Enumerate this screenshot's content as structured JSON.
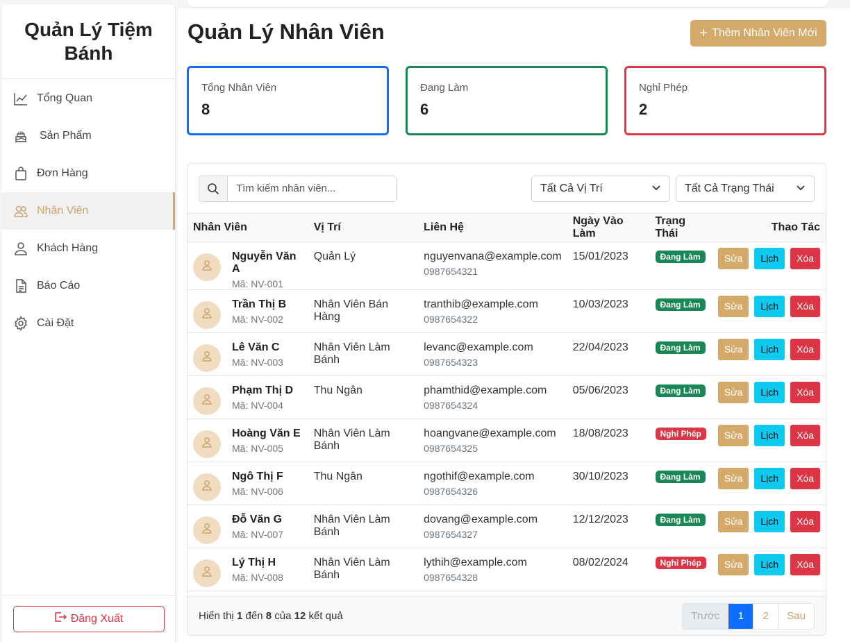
{
  "brand": "Quản Lý Tiệm Bánh",
  "nav": [
    {
      "label": "Tổng Quan",
      "icon": "chart-line-icon"
    },
    {
      "label": "Sản Phẩm",
      "icon": "cake-icon"
    },
    {
      "label": "Đơn Hàng",
      "icon": "shopping-bag-icon"
    },
    {
      "label": "Nhân Viên",
      "icon": "users-icon"
    },
    {
      "label": "Khách Hàng",
      "icon": "user-icon"
    },
    {
      "label": "Báo Cáo",
      "icon": "document-icon"
    },
    {
      "label": "Cài Đặt",
      "icon": "gear-icon"
    }
  ],
  "logout_label": "Đăng Xuất",
  "page_title": "Quản Lý Nhân Viên",
  "add_button": "Thêm Nhân Viên Mới",
  "stats": {
    "total": {
      "label": "Tổng Nhân Viên",
      "value": "8"
    },
    "working": {
      "label": "Đang Làm",
      "value": "6"
    },
    "leave": {
      "label": "Nghỉ Phép",
      "value": "2"
    }
  },
  "search": {
    "placeholder": "Tìm kiếm nhân viên..."
  },
  "filters": {
    "position": "Tất Cả Vị Trí",
    "status": "Tất Cả Trạng Thái"
  },
  "columns": {
    "employee": "Nhân Viên",
    "position": "Vị Trí",
    "contact": "Liên Hệ",
    "start_date": "Ngày Vào Làm",
    "status": "Trạng Thái",
    "actions": "Thao Tác"
  },
  "actions": {
    "edit": "Sửa",
    "schedule": "Lịch",
    "delete": "Xóa"
  },
  "employees": [
    {
      "name": "Nguyễn Văn A",
      "code": "Mã: NV-001",
      "position": "Quản Lý",
      "email": "nguyenvana@example.com",
      "phone": "0987654321",
      "date": "15/01/2023",
      "status": "Đang Làm"
    },
    {
      "name": "Trần Thị B",
      "code": "Mã: NV-002",
      "position": "Nhân Viên Bán Hàng",
      "email": "tranthib@example.com",
      "phone": "0987654322",
      "date": "10/03/2023",
      "status": "Đang Làm"
    },
    {
      "name": "Lê Văn C",
      "code": "Mã: NV-003",
      "position": "Nhân Viên Làm Bánh",
      "email": "levanc@example.com",
      "phone": "0987654323",
      "date": "22/04/2023",
      "status": "Đang Làm"
    },
    {
      "name": "Phạm Thị D",
      "code": "Mã: NV-004",
      "position": "Thu Ngân",
      "email": "phamthid@example.com",
      "phone": "0987654324",
      "date": "05/06/2023",
      "status": "Đang Làm"
    },
    {
      "name": "Hoàng Văn E",
      "code": "Mã: NV-005",
      "position": "Nhân Viên Làm Bánh",
      "email": "hoangvane@example.com",
      "phone": "0987654325",
      "date": "18/08/2023",
      "status": "Nghỉ Phép"
    },
    {
      "name": "Ngô Thị F",
      "code": "Mã: NV-006",
      "position": "Thu Ngân",
      "email": "ngothif@example.com",
      "phone": "0987654326",
      "date": "30/10/2023",
      "status": "Đang Làm"
    },
    {
      "name": "Đỗ Văn G",
      "code": "Mã: NV-007",
      "position": "Nhân Viên Làm Bánh",
      "email": "dovang@example.com",
      "phone": "0987654327",
      "date": "12/12/2023",
      "status": "Đang Làm"
    },
    {
      "name": "Lý Thị H",
      "code": "Mã: NV-008",
      "position": "Nhân Viên Làm Bánh",
      "email": "lythih@example.com",
      "phone": "0987654328",
      "date": "08/02/2024",
      "status": "Nghỉ Phép"
    }
  ],
  "footer": {
    "prefix": "Hiển thị",
    "from": "1",
    "to_word": "đến",
    "to": "8",
    "of_word": "của",
    "total": "12",
    "suffix": "kết quả"
  },
  "pager": {
    "prev": "Trước",
    "pages": [
      "1",
      "2"
    ],
    "next": "Sau"
  },
  "colors": {
    "accent": "#d4aa6a",
    "primary": "#0d6efd",
    "success": "#198754",
    "danger": "#dc3545",
    "info": "#0dcaf0"
  }
}
